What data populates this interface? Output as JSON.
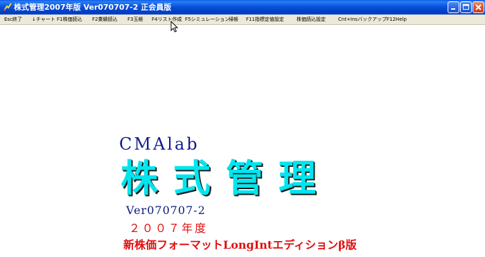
{
  "window": {
    "title": "株式管理2007年版 Ver070707-2 正会員版"
  },
  "menu": {
    "items": [
      "Esc終了",
      "↓チャート",
      "F1株価読込",
      "F2業績読込",
      "F3玉帳",
      "F4リスト作成",
      "F5シミュレーション",
      "帰帳",
      "F11指標定値設定",
      "株価読込設定",
      "Cnt+Insバックアップ",
      "F12Help"
    ]
  },
  "splash": {
    "brand": "CMAlab",
    "product": "株式管理",
    "version": "Ver070707-2",
    "year": "２００７年度",
    "edition": "新株価フォーマットLongIntエディションβ版"
  },
  "colors": {
    "titlebar": "#0a52da",
    "menubar": "#ece9d8",
    "brand": "#0e1c8e",
    "product": "#00e6ee",
    "accent_red": "#e01010"
  },
  "icons": {
    "app": "app-icon",
    "minimize": "minimize-icon",
    "maximize": "maximize-icon",
    "close": "close-icon",
    "cursor": "mouse-cursor-icon"
  }
}
